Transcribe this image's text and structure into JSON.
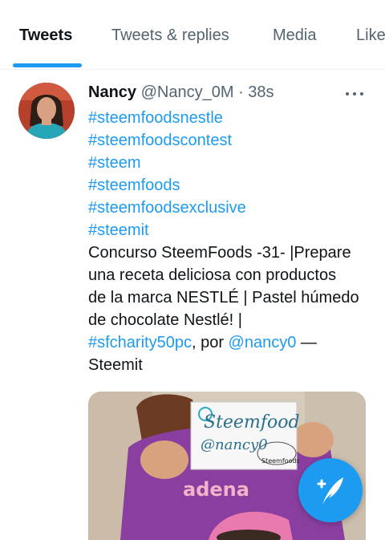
{
  "tabs": {
    "items": [
      "Tweets",
      "Tweets & replies",
      "Media",
      "Likes"
    ]
  },
  "tweet": {
    "name": "Nancy",
    "handle": "@Nancy_0M",
    "separator": "·",
    "time": "38s",
    "hashtags": [
      "#steemfoodsnestle",
      "#steemfoodscontest",
      "#steem",
      "#steemfoods",
      "#steemfoodsexclusive",
      "#steemit"
    ],
    "text_lines": [
      "Concurso SteemFoods -31- |Prepare",
      "una receta deliciosa con productos",
      "de la marca NESTLÉ | Pastel húmedo",
      "de chocolate Nestlé! |"
    ],
    "tag_inline": "#sfcharity50pc",
    "por": ", por ",
    "mention": "@nancy0",
    "dash": " —",
    "last_line": "Steemit",
    "media": {
      "sign_line1": "Steemfood",
      "sign_line2": "@nancy0",
      "sign_brand": "Steemfoods",
      "shirt_text": "adena"
    }
  },
  "icons": {
    "more": "more-horizontal-icon",
    "compose": "compose-tweet-icon"
  },
  "colors": {
    "accent": "#1d9bf0",
    "text": "#0f1419",
    "muted": "#536471"
  }
}
